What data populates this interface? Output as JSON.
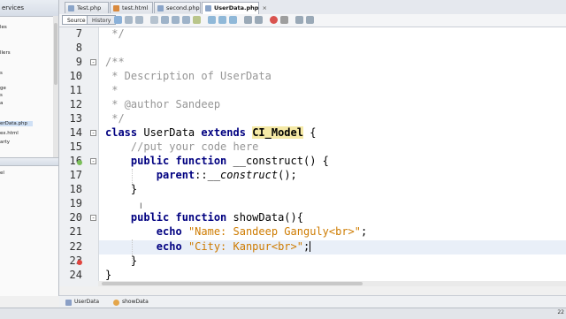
{
  "project_panel": {
    "title": "ervices",
    "items": [
      "les",
      "llers",
      "s",
      "ge",
      "s",
      "a"
    ],
    "selected": "erData.php",
    "after": [
      "ex.html",
      "arty"
    ],
    "lower": [
      "el"
    ]
  },
  "tabs": [
    {
      "label": "Test.php"
    },
    {
      "label": "test.html"
    },
    {
      "label": "second.php"
    },
    {
      "label": "UserData.php"
    }
  ],
  "toolbar": {
    "source": "Source",
    "history": "History"
  },
  "editor": {
    "lines": [
      {
        "n": "7"
      },
      {
        "n": "8"
      },
      {
        "n": "9"
      },
      {
        "n": "10",
        "text": " * Description of UserData"
      },
      {
        "n": "11",
        "text": " *"
      },
      {
        "n": "12",
        "text": " * @author Sandeep"
      },
      {
        "n": "13",
        "text": " */"
      },
      {
        "n": "14"
      },
      {
        "n": "15",
        "text": "    //put your code here"
      },
      {
        "n": "16"
      },
      {
        "n": "17"
      },
      {
        "n": "18",
        "text": "    }"
      },
      {
        "n": "19"
      },
      {
        "n": "20"
      },
      {
        "n": "21"
      },
      {
        "n": "22"
      },
      {
        "n": "23",
        "text": "    }"
      },
      {
        "n": "24",
        "text": "}"
      }
    ],
    "tokens": {
      "l7": " */",
      "l9": "/**",
      "l14_kw1": "class",
      "l14_name": " UserData ",
      "l14_kw2": "extends",
      "l14_sp": " ",
      "l14_cls": "CI_Model",
      "l14_end": " {",
      "l16_kw1": "    public",
      "l16_kw2": " function",
      "l16_rest": " __construct() {",
      "l17_kw": "        parent",
      "l17_sep": "::",
      "l17_it": "__construct",
      "l17_end": "();",
      "l20_kw1": "    public",
      "l20_kw2": " function",
      "l20_rest": " showData(){",
      "l21_kw": "        echo",
      "l21_sp": " ",
      "l21_str": "\"Name: Sandeep Ganguly<br>\"",
      "l21_end": ";",
      "l22_kw": "        echo",
      "l22_sp": " ",
      "l22_str": "\"City: Kanpur<br>\"",
      "l22_end": ";"
    }
  },
  "navigator": {
    "class_crumb": "UserData",
    "method_crumb": "showData"
  },
  "status": {
    "position": "22"
  },
  "colors": {
    "keyword": "#000080",
    "comment": "#969696",
    "string": "#ce7b00",
    "class_highlight": "#f5e9a6",
    "current_line": "#e9eff8"
  }
}
